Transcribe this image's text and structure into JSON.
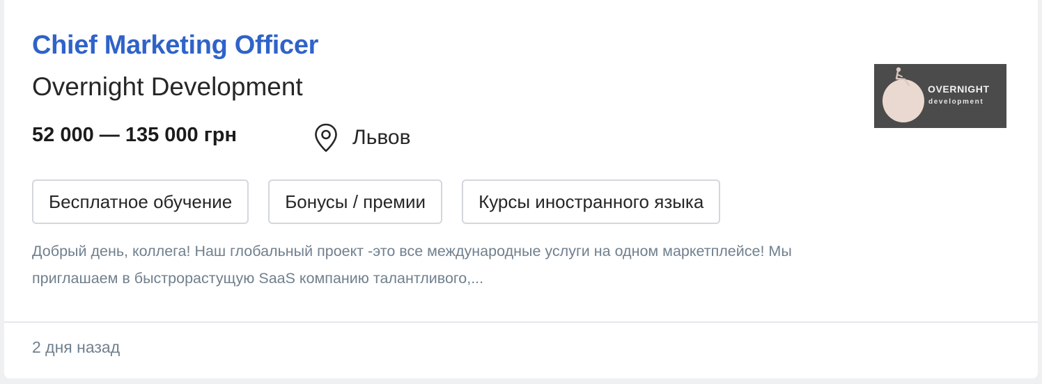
{
  "vacancy": {
    "title": "Chief Marketing Officer",
    "company": "Overnight Development",
    "salary": "52 000 — 135 000 грн",
    "location": "Львов",
    "location_icon": "map-pin-icon",
    "logo": {
      "wordmark": "OVERNIGHT",
      "subtitle": "development"
    },
    "benefits": [
      "Бесплатное обучение",
      "Бонусы / премии",
      "Курсы иностранного языка"
    ],
    "snippet_line1": "Добрый день, коллега! Наш глобальный проект -это все международные услуги на одном маркетплейсе! Мы",
    "snippet_line2": "приглашаем в быстрорастущую SaaS компанию талантливого,...",
    "posted": "2 дня назад"
  },
  "colors": {
    "title_link": "#2f63c9",
    "muted_text": "#70808e",
    "tag_border": "#d3d7dc",
    "logo_bg": "#4b4b4b"
  }
}
